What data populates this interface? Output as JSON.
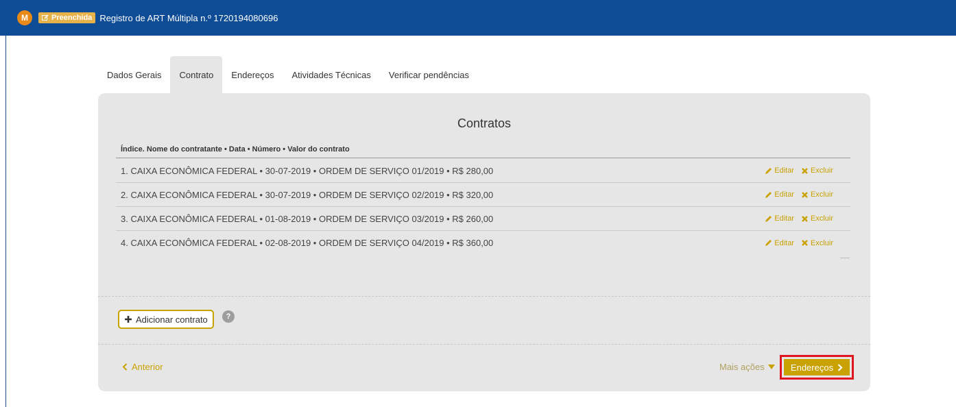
{
  "header": {
    "avatar_letter": "M",
    "status_badge": "Preenchida",
    "title": "Registro de ART Múltipla n.º 1720194080696",
    "bg_color": "#0e4c96"
  },
  "tabs": [
    {
      "label": "Dados Gerais",
      "active": false
    },
    {
      "label": "Contrato",
      "active": true
    },
    {
      "label": "Endereços",
      "active": false
    },
    {
      "label": "Atividades Técnicas",
      "active": false
    },
    {
      "label": "Verificar pendências",
      "active": false
    }
  ],
  "panel": {
    "title": "Contratos",
    "list_header": "Índice. Nome do contratante • Data • Número • Valor do contrato",
    "rows": [
      {
        "text": "1. CAIXA ECONÔMICA FEDERAL • 30-07-2019 • ORDEM DE SERVIÇO 01/2019 • R$ 280,00",
        "edit": "Editar",
        "delete": "Excluir"
      },
      {
        "text": "2. CAIXA ECONÔMICA FEDERAL • 30-07-2019 • ORDEM DE SERVIÇO 02/2019 • R$ 320,00",
        "edit": "Editar",
        "delete": "Excluir"
      },
      {
        "text": "3. CAIXA ECONÔMICA FEDERAL • 01-08-2019 • ORDEM DE SERVIÇO 03/2019 • R$ 260,00",
        "edit": "Editar",
        "delete": "Excluir"
      },
      {
        "text": "4. CAIXA ECONÔMICA FEDERAL • 02-08-2019 • ORDEM DE SERVIÇO 04/2019 • R$ 360,00",
        "edit": "Editar",
        "delete": "Excluir"
      }
    ],
    "add_label": "Adicionar contrato",
    "help_label": "?"
  },
  "footer": {
    "prev_label": "Anterior",
    "more_label": "Mais ações",
    "next_label": "Endereços",
    "accent_color": "#c9a100",
    "highlight_color": "#e0141f"
  }
}
